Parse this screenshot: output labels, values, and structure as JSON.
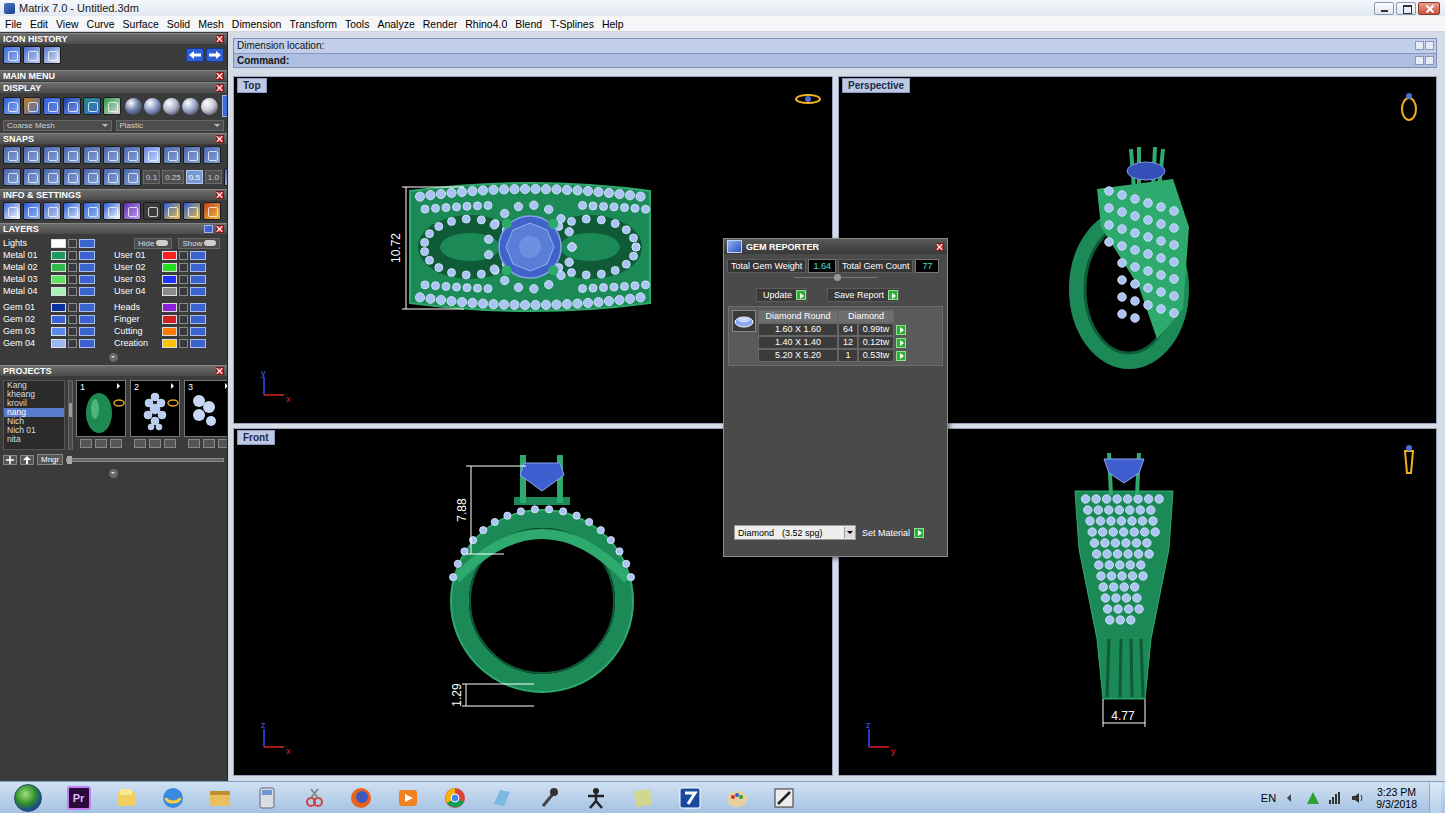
{
  "window": {
    "title": "Matrix 7.0 - Untitled.3dm"
  },
  "menu": [
    "File",
    "Edit",
    "View",
    "Curve",
    "Surface",
    "Solid",
    "Mesh",
    "Dimension",
    "Transform",
    "Tools",
    "Analyze",
    "Render",
    "Rhino4.0",
    "Blend",
    "T-Splines",
    "Help"
  ],
  "panel": {
    "icon_history": "ICON HISTORY",
    "main_menu": "MAIN MENU",
    "display": {
      "title": "DISPLAY",
      "mesh": "Coarse Mesh",
      "material": "Plastic"
    },
    "snaps": {
      "title": "SNAPS",
      "steps": [
        {
          "label": "0.1",
          "selected": false
        },
        {
          "label": "0.25",
          "selected": false
        },
        {
          "label": "0.5",
          "selected": true
        },
        {
          "label": "1.0",
          "selected": false
        }
      ]
    },
    "info": "INFO & SETTINGS",
    "layers": {
      "title": "LAYERS",
      "lights": {
        "name": "Lights",
        "color": "#ffffff"
      },
      "hide": "Hide",
      "show": "Show",
      "metal_rows": [
        {
          "left": {
            "name": "Metal 01",
            "color": "#1f9a5e"
          },
          "right": {
            "name": "User 01",
            "color": "#ff2020"
          }
        },
        {
          "left": {
            "name": "Metal 02",
            "color": "#2cb84a"
          },
          "right": {
            "name": "User 02",
            "color": "#20e020"
          }
        },
        {
          "left": {
            "name": "Metal 03",
            "color": "#60e060"
          },
          "right": {
            "name": "User 03",
            "color": "#2030ff"
          }
        },
        {
          "left": {
            "name": "Metal 04",
            "color": "#a8f0b8"
          },
          "right": {
            "name": "User 04",
            "color": "#8a8a8a"
          }
        }
      ],
      "gem_rows": [
        {
          "left": {
            "name": "Gem 01",
            "color": "#0b30a0"
          },
          "right": {
            "name": "Heads",
            "color": "#8a20d8"
          }
        },
        {
          "left": {
            "name": "Gem 02",
            "color": "#3b63d8"
          },
          "right": {
            "name": "Finger",
            "color": "#d02020"
          }
        },
        {
          "left": {
            "name": "Gem 03",
            "color": "#5b8ae8"
          },
          "right": {
            "name": "Cutting",
            "color": "#ff7a00"
          }
        },
        {
          "left": {
            "name": "Gem 04",
            "color": "#9ab8f0"
          },
          "right": {
            "name": "Creation",
            "color": "#ffc400"
          }
        }
      ]
    },
    "projects": {
      "title": "PROJECTS",
      "items": [
        {
          "label": "Kang",
          "selected": false
        },
        {
          "label": "kheang",
          "selected": false
        },
        {
          "label": "krovil",
          "selected": false
        },
        {
          "label": "nang",
          "selected": true
        },
        {
          "label": "Nich",
          "selected": false
        },
        {
          "label": "Nich 01",
          "selected": false
        },
        {
          "label": "nita",
          "selected": false
        }
      ],
      "thumbs": [
        "1",
        "2",
        "3"
      ],
      "manager": "Mngr"
    }
  },
  "command": {
    "prompt": "Dimension location:",
    "label": "Command:"
  },
  "viewports": [
    {
      "label": "Top",
      "kind": "top",
      "dimensions": [
        "10.72"
      ],
      "axes": [
        "y",
        "x"
      ]
    },
    {
      "label": "Perspective",
      "kind": "perspective",
      "dimensions": [],
      "axes": []
    },
    {
      "label": "Front",
      "kind": "front",
      "dimensions": [
        "7.88",
        "1.29"
      ],
      "axes": [
        "z",
        "x"
      ]
    },
    {
      "kind": "right",
      "dimensions": [
        "4.77"
      ],
      "axes": [
        "z",
        "y"
      ]
    }
  ],
  "gem_reporter": {
    "title": "GEM REPORTER",
    "weight_label": "Total Gem Weight",
    "weight": "1.64",
    "count_label": "Total Gem Count",
    "count": "77",
    "update": "Update",
    "save": "Save Report",
    "columns": [
      "Diamond Round",
      "Diamond"
    ],
    "rows": [
      [
        "1.60 X 1.60",
        "64",
        "0.99tw"
      ],
      [
        "1.40 X 1.40",
        "12",
        "0.12tw"
      ],
      [
        "5.20 X 5.20",
        "1",
        "0.53tw"
      ]
    ],
    "material": "Diamond",
    "density": "(3.52 spg)",
    "set_material": "Set Material"
  },
  "taskbar": {
    "premiere": "Pr",
    "language": "EN",
    "time": "3:23 PM",
    "date": "9/3/2018"
  }
}
